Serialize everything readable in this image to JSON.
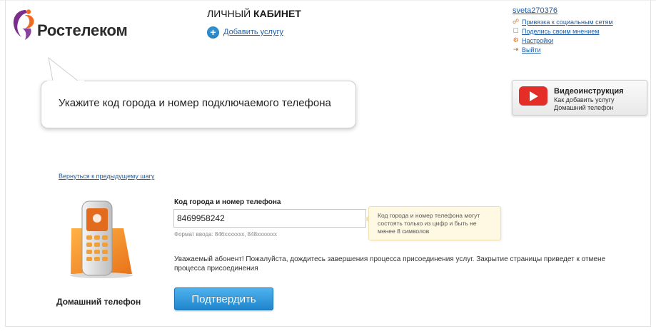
{
  "header": {
    "brand_name": "Ростелеком",
    "cabinet_title_prefix": "ЛИЧНЫЙ",
    "cabinet_title_bold": "КАБИНЕТ",
    "add_service_label": "Добавить услугу"
  },
  "user_menu": {
    "username": "sveta270376",
    "items": [
      {
        "label": "Привязка к социальным сетям",
        "icon": "link-icon"
      },
      {
        "label": "Поделись своим мнением",
        "icon": "comment-icon"
      },
      {
        "label": "Настройки",
        "icon": "settings-icon"
      },
      {
        "label": "Выйти",
        "icon": "logout-icon"
      }
    ]
  },
  "bubble": {
    "text": "Укажите код города и номер подключаемого телефона"
  },
  "video": {
    "title": "Видеоинструкция",
    "subtitle_line1": "Как добавить услугу",
    "subtitle_line2": "Домашний телефон",
    "icon": "youtube-play-icon"
  },
  "back_link": "Вернуться к предыдущему шагу",
  "service": {
    "caption": "Домашний телефон",
    "icon": "home-phone-icon"
  },
  "form": {
    "label": "Код города и номер телефона",
    "value": "8469958242",
    "format_hint": "Формат ввода: 846xxxxxxx, 848xxxxxxx",
    "tip": "Код города и номер телефона могут состоять только из цифр и быть не менее 8 символов",
    "notice": "Уважаемый абонент! Пожалуйста, дождитесь завершения процесса присоединения услуг. Закрытие страницы приведет к отмене процесса присоединения",
    "submit_label": "Подтвердить"
  },
  "colors": {
    "link": "#1e5fa8",
    "button": "#2896dc",
    "brand_orange": "#f26a21",
    "brand_purple": "#7b2d8e"
  }
}
